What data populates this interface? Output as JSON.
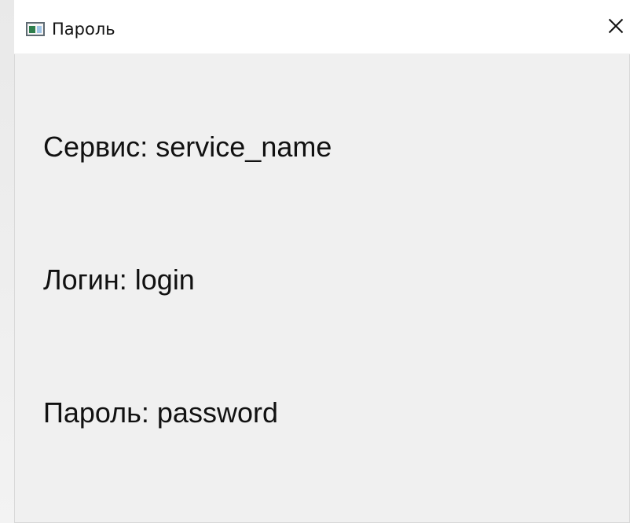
{
  "window": {
    "title": "Пароль",
    "close_label": "✕"
  },
  "details": {
    "service": "Сервис: service_name",
    "login": "Логин: login",
    "password": "Пароль: password"
  },
  "icons": {
    "app": "app-window-icon",
    "close": "close-icon"
  },
  "colors": {
    "window_background": "#f0f0f0",
    "title_bar_background": "#ffffff",
    "text": "#111111"
  }
}
